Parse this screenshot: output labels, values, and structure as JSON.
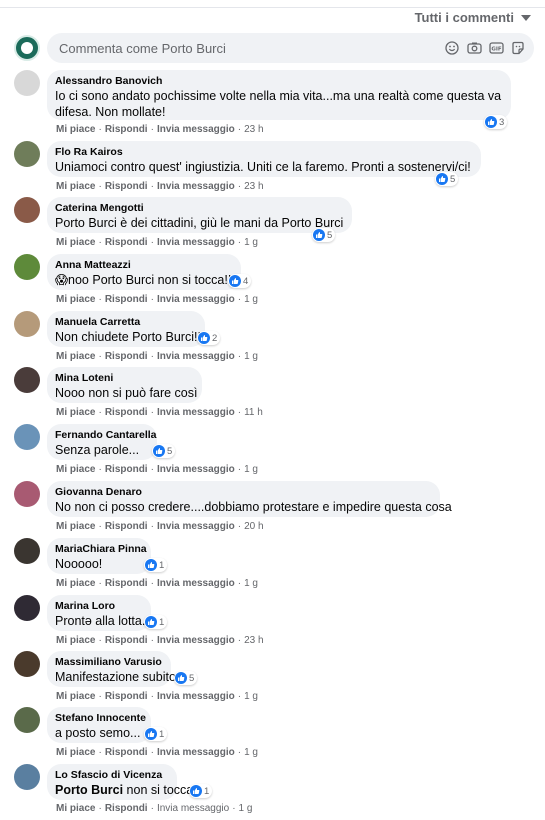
{
  "header": {
    "sort_label": "Tutti i commenti"
  },
  "composer": {
    "placeholder": "Commenta come Porto Burci",
    "icons": [
      "emoji-icon",
      "camera-icon",
      "gif-icon",
      "sticker-icon"
    ]
  },
  "actions_labels": {
    "like": "Mi piace",
    "reply": "Rispondi",
    "message": "Invia messaggio"
  },
  "colors": {
    "like_blue": "#1877f2",
    "bubble_bg": "#f0f2f5",
    "meta_gray": "#65676b"
  },
  "comments": [
    {
      "author": "Alessandro Banovich",
      "lines": [
        "Io ci sono andato pochissime volte nella mia vita...ma una realtà come questa va",
        "difesa. Non mollate!"
      ],
      "likes": "3",
      "time": "23 h"
    },
    {
      "author": "Flo Ra Kairos",
      "lines": [
        "Uniamoci contro quest' ingiustizia. Uniti ce la faremo. Pronti a sostenervi/ci!"
      ],
      "likes": "5",
      "time": "23 h"
    },
    {
      "author": "Caterina Mengotti",
      "lines": [
        "Porto Burci è dei cittadini, giù le mani da Porto Burci"
      ],
      "likes": "5",
      "time": "1 g"
    },
    {
      "author": "Anna Matteazzi",
      "lines": [
        "😱noo Porto Burci non si tocca!!"
      ],
      "likes": "4",
      "time": "1 g"
    },
    {
      "author": "Manuela Carretta",
      "lines": [
        "Non chiudete Porto Burci!!"
      ],
      "likes": "2",
      "time": "1 g"
    },
    {
      "author": "Mina Loteni",
      "lines": [
        "Nooo non si può fare così"
      ],
      "likes": "",
      "time": "11 h"
    },
    {
      "author": "Fernando Cantarella",
      "lines": [
        "Senza parole..."
      ],
      "likes": "5",
      "time": "1 g"
    },
    {
      "author": "Giovanna Denaro",
      "lines": [
        "No non ci posso credere....dobbiamo protestare e impedire questa cosa"
      ],
      "likes": "",
      "time": "20 h"
    },
    {
      "author": "MariaChiara Pinna",
      "lines": [
        "Nooooo!"
      ],
      "likes": "1",
      "time": "1 g"
    },
    {
      "author": "Marina Loro",
      "lines": [
        "Prontə alla lotta."
      ],
      "likes": "1",
      "time": "23 h"
    },
    {
      "author": "Massimiliano Varusio",
      "lines": [
        "Manifestazione subito"
      ],
      "likes": "5",
      "time": "1 g"
    },
    {
      "author": "Stefano Innocente",
      "lines": [
        "a posto semo..."
      ],
      "likes": "1",
      "time": "1 g"
    },
    {
      "author": "Lo Sfascio di Vicenza",
      "lines": [
        "Porto Burci non si tocca!"
      ],
      "bold_prefix": "Porto Burci",
      "likes": "1",
      "time": "1 g"
    }
  ]
}
